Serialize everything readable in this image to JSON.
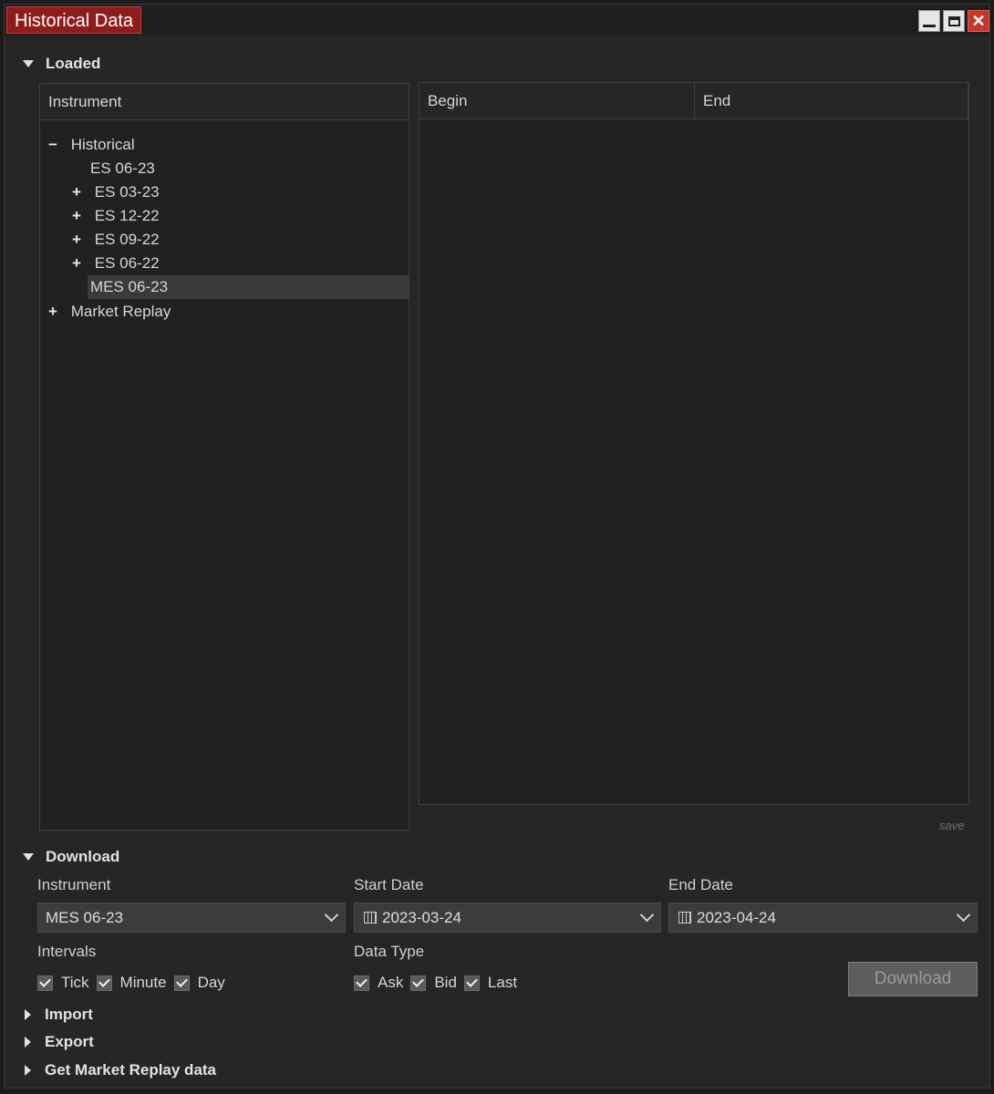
{
  "window": {
    "title": "Historical Data"
  },
  "loaded": {
    "header": "Loaded",
    "instrument_column": "Instrument",
    "tree": {
      "historical_label": "Historical",
      "items": [
        "ES 06-23",
        "ES 03-23",
        "ES 12-22",
        "ES 09-22",
        "ES 06-22",
        "MES 06-23"
      ],
      "market_replay_label": "Market Replay"
    },
    "data_columns": [
      "Begin",
      "End"
    ],
    "save_label": "save"
  },
  "download": {
    "header": "Download",
    "instrument_label": "Instrument",
    "instrument_value": "MES 06-23",
    "start_date_label": "Start Date",
    "start_date_value": "2023-03-24",
    "end_date_label": "End Date",
    "end_date_value": "2023-04-24",
    "intervals_label": "Intervals",
    "intervals": [
      {
        "label": "Tick",
        "checked": true
      },
      {
        "label": "Minute",
        "checked": true
      },
      {
        "label": "Day",
        "checked": true
      }
    ],
    "data_type_label": "Data Type",
    "data_types": [
      {
        "label": "Ask",
        "checked": true
      },
      {
        "label": "Bid",
        "checked": true
      },
      {
        "label": "Last",
        "checked": true
      }
    ],
    "button_label": "Download"
  },
  "collapsed_sections": [
    "Import",
    "Export",
    "Get Market Replay data"
  ],
  "colors": {
    "title_accent": "#8f1c1c",
    "background": "#262626",
    "close_button": "#c0392b"
  }
}
